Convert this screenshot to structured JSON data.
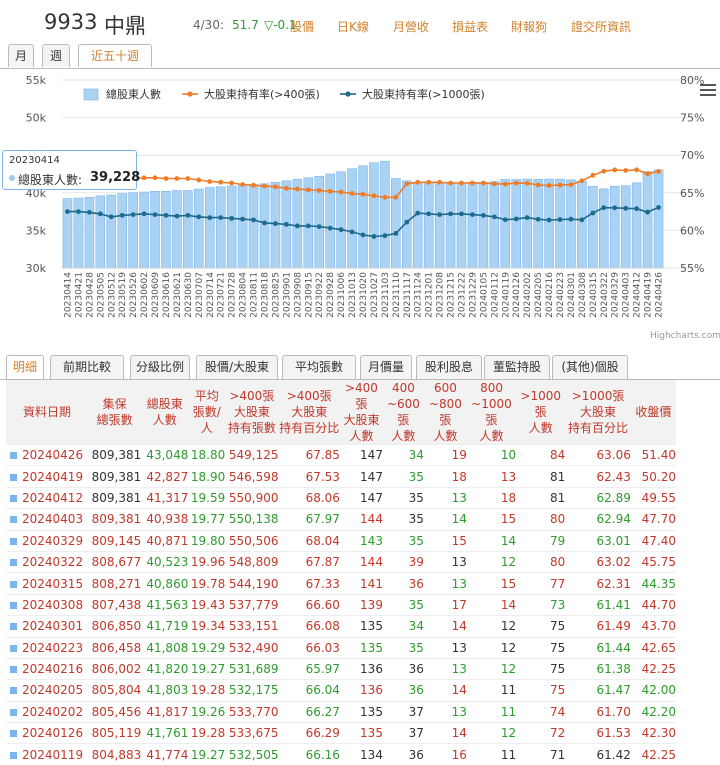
{
  "header": {
    "code": "9933",
    "name": "中鼎",
    "date": "4/30:",
    "price": "51.7",
    "change": "▽-0.1",
    "nav": [
      "股價",
      "日K線",
      "月營收",
      "損益表",
      "財報狗",
      "證交所資訊"
    ]
  },
  "range_tabs": [
    "月",
    "週",
    "近五十週"
  ],
  "tooltip": {
    "date": "20230414",
    "label": "總股東人數:",
    "value": "39,228"
  },
  "credit": "Highcharts.com",
  "chart_data": {
    "type": "bar+line",
    "legend": [
      "總股東人數",
      "大股東持有率(>400張)",
      "大股東持有率(>1000張)"
    ],
    "legend_position": "top",
    "y_left": {
      "ticks": [
        "30k",
        "35k",
        "40k",
        "45k",
        "50k",
        "55k"
      ],
      "range": [
        30000,
        55000
      ]
    },
    "y_right": {
      "ticks": [
        "55%",
        "60%",
        "65%",
        "70%",
        "75%",
        "80%"
      ],
      "range": [
        55,
        80
      ]
    },
    "x": [
      "20230414",
      "20230421",
      "20230428",
      "20230505",
      "20230512",
      "20230519",
      "20230526",
      "20230602",
      "20230609",
      "20230616",
      "20230621",
      "20230630",
      "20230707",
      "20230714",
      "20230721",
      "20230728",
      "20230804",
      "20230811",
      "20230818",
      "20230825",
      "20230901",
      "20230908",
      "20230915",
      "20230922",
      "20230928",
      "20231006",
      "20231013",
      "20231020",
      "20231027",
      "20231103",
      "20231110",
      "20231117",
      "20231124",
      "20231201",
      "20231208",
      "20231215",
      "20231222",
      "20231229",
      "20240105",
      "20240112",
      "20240119",
      "20240126",
      "20240202",
      "20240205",
      "20240216",
      "20240223",
      "20240301",
      "20240308",
      "20240315",
      "20240322",
      "20240329",
      "20240403",
      "20240412",
      "20240419",
      "20240426"
    ],
    "x_labels": [
      "20230414",
      "20230421",
      "20230428",
      "20230505",
      "20230512",
      "20230519",
      "20230526",
      "20230602",
      "20230609",
      "20230616",
      "20230621",
      "20230630",
      "20230707",
      "20230714",
      "20230721",
      "20230728",
      "20230804",
      "20230811",
      "20230818",
      "20230825",
      "20230901",
      "20230908",
      "20230915",
      "20230922",
      "20230928",
      "20231006",
      "20231013",
      "20231020",
      "20231027",
      "20231103",
      "20231110",
      "20231117",
      "20231124",
      "20231201",
      "20231208",
      "20231215",
      "20231222",
      "20231229",
      "20240105",
      "20240112",
      "20240119",
      "20240126",
      "20240202",
      "20240205",
      "20240216",
      "20240223",
      "20240301",
      "20240308",
      "20240315",
      "20240322",
      "20240329",
      "20240403",
      "20240412",
      "20240419",
      "20240426"
    ],
    "series": [
      {
        "name": "總股東人數",
        "type": "column",
        "values": [
          39228,
          39300,
          39400,
          39600,
          39700,
          39900,
          40000,
          40100,
          40200,
          40200,
          40300,
          40300,
          40500,
          40700,
          40800,
          40900,
          41000,
          41100,
          41200,
          41400,
          41600,
          41800,
          42000,
          42200,
          42500,
          42800,
          43200,
          43600,
          44000,
          44200,
          41900,
          41600,
          41400,
          41300,
          41200,
          41200,
          41300,
          41400,
          41400,
          41500,
          41774,
          41761,
          41817,
          41803,
          41820,
          41808,
          41719,
          41563,
          40860,
          40523,
          40871,
          40938,
          41317,
          42827,
          43048
        ]
      },
      {
        "name": "大股東持有率(>400張)",
        "type": "line",
        "values": [
          66.9,
          66.9,
          66.8,
          66.7,
          66.7,
          66.8,
          66.9,
          67.0,
          67.0,
          66.9,
          66.9,
          66.9,
          66.7,
          66.5,
          66.4,
          66.3,
          66.1,
          66.0,
          65.9,
          65.8,
          65.6,
          65.5,
          65.4,
          65.3,
          65.2,
          65.1,
          64.9,
          64.8,
          64.6,
          64.4,
          64.4,
          66.2,
          66.4,
          66.4,
          66.4,
          66.3,
          66.3,
          66.3,
          66.3,
          66.2,
          66.16,
          66.29,
          66.27,
          66.04,
          65.97,
          66.03,
          66.08,
          66.6,
          67.33,
          67.87,
          68.04,
          67.97,
          68.06,
          67.53,
          67.85
        ]
      },
      {
        "name": "大股東持有率(>1000張)",
        "type": "line",
        "values": [
          62.5,
          62.5,
          62.4,
          62.2,
          61.8,
          62.0,
          62.1,
          62.2,
          62.1,
          62.0,
          61.9,
          62.0,
          61.8,
          61.7,
          61.7,
          61.6,
          61.5,
          61.4,
          61.0,
          60.9,
          60.8,
          60.6,
          60.6,
          60.5,
          60.3,
          60.1,
          59.8,
          59.4,
          59.2,
          59.3,
          59.6,
          61.1,
          62.3,
          62.2,
          62.1,
          62.2,
          62.2,
          62.1,
          62.0,
          61.8,
          61.42,
          61.53,
          61.7,
          61.47,
          61.38,
          61.44,
          61.49,
          61.41,
          62.31,
          63.02,
          63.01,
          62.94,
          62.89,
          62.43,
          63.06
        ]
      }
    ]
  },
  "tabs": [
    "明細",
    "前期比較",
    "分級比例",
    "股價/大股東",
    "平均張數",
    "月價量",
    "股利股息",
    "董監持股",
    "(其他)個股"
  ],
  "table": {
    "headers": [
      "資料日期",
      "集保\n總張數",
      "總股東\n人數",
      "平均\n張數/人",
      ">400張\n大股東\n持有張數",
      ">400張\n大股東\n持有百分比",
      ">400張\n大股東\n人數",
      "400\n~600張\n人數",
      "600\n~800張\n人數",
      "800\n~1000張\n人數",
      ">1000張\n人數",
      ">1000張\n大股東\n持有百分比",
      "收盤價"
    ],
    "rows": [
      [
        "20240426",
        "809,381",
        "43,048",
        "18.80",
        "549,125",
        "67.85",
        "147",
        "34",
        "19",
        "10",
        "84",
        "63.06",
        "51.40"
      ],
      [
        "20240419",
        "809,381",
        "42,827",
        "18.90",
        "546,598",
        "67.53",
        "147",
        "35",
        "18",
        "13",
        "81",
        "62.43",
        "50.20"
      ],
      [
        "20240412",
        "809,381",
        "41,317",
        "19.59",
        "550,900",
        "68.06",
        "147",
        "35",
        "13",
        "18",
        "81",
        "62.89",
        "49.55"
      ],
      [
        "20240403",
        "809,381",
        "40,938",
        "19.77",
        "550,138",
        "67.97",
        "144",
        "35",
        "14",
        "15",
        "80",
        "62.94",
        "47.70"
      ],
      [
        "20240329",
        "809,145",
        "40,871",
        "19.80",
        "550,506",
        "68.04",
        "143",
        "35",
        "15",
        "14",
        "79",
        "63.01",
        "47.40"
      ],
      [
        "20240322",
        "808,677",
        "40,523",
        "19.96",
        "548,809",
        "67.87",
        "144",
        "39",
        "13",
        "12",
        "80",
        "63.02",
        "45.75"
      ],
      [
        "20240315",
        "808,271",
        "40,860",
        "19.78",
        "544,190",
        "67.33",
        "141",
        "36",
        "13",
        "15",
        "77",
        "62.31",
        "44.35"
      ],
      [
        "20240308",
        "807,438",
        "41,563",
        "19.43",
        "537,779",
        "66.60",
        "139",
        "35",
        "17",
        "14",
        "73",
        "61.41",
        "44.70"
      ],
      [
        "20240301",
        "806,850",
        "41,719",
        "19.34",
        "533,151",
        "66.08",
        "135",
        "34",
        "14",
        "12",
        "75",
        "61.49",
        "43.70"
      ],
      [
        "20240223",
        "806,458",
        "41,808",
        "19.29",
        "532,490",
        "66.03",
        "135",
        "35",
        "13",
        "12",
        "75",
        "61.44",
        "42.65"
      ],
      [
        "20240216",
        "806,002",
        "41,820",
        "19.27",
        "531,689",
        "65.97",
        "136",
        "36",
        "13",
        "12",
        "75",
        "61.38",
        "42.25"
      ],
      [
        "20240205",
        "805,804",
        "41,803",
        "19.28",
        "532,175",
        "66.04",
        "136",
        "36",
        "14",
        "11",
        "75",
        "61.47",
        "42.00"
      ],
      [
        "20240202",
        "805,456",
        "41,817",
        "19.26",
        "533,770",
        "66.27",
        "135",
        "37",
        "13",
        "11",
        "74",
        "61.70",
        "42.20"
      ],
      [
        "20240126",
        "805,119",
        "41,761",
        "19.28",
        "533,675",
        "66.29",
        "135",
        "37",
        "14",
        "12",
        "72",
        "61.53",
        "42.30"
      ],
      [
        "20240119",
        "804,883",
        "41,774",
        "19.27",
        "532,505",
        "66.16",
        "134",
        "36",
        "16",
        "11",
        "71",
        "61.42",
        "42.25"
      ]
    ]
  },
  "colors": {
    "bar": "#a9d2f3",
    "bar_edge": "#7cb5ec",
    "line400": "#f07c27",
    "line1000": "#1f6b8e",
    "accent": "#d2822c",
    "red": "#c0392b",
    "green": "#2e9b2e"
  }
}
